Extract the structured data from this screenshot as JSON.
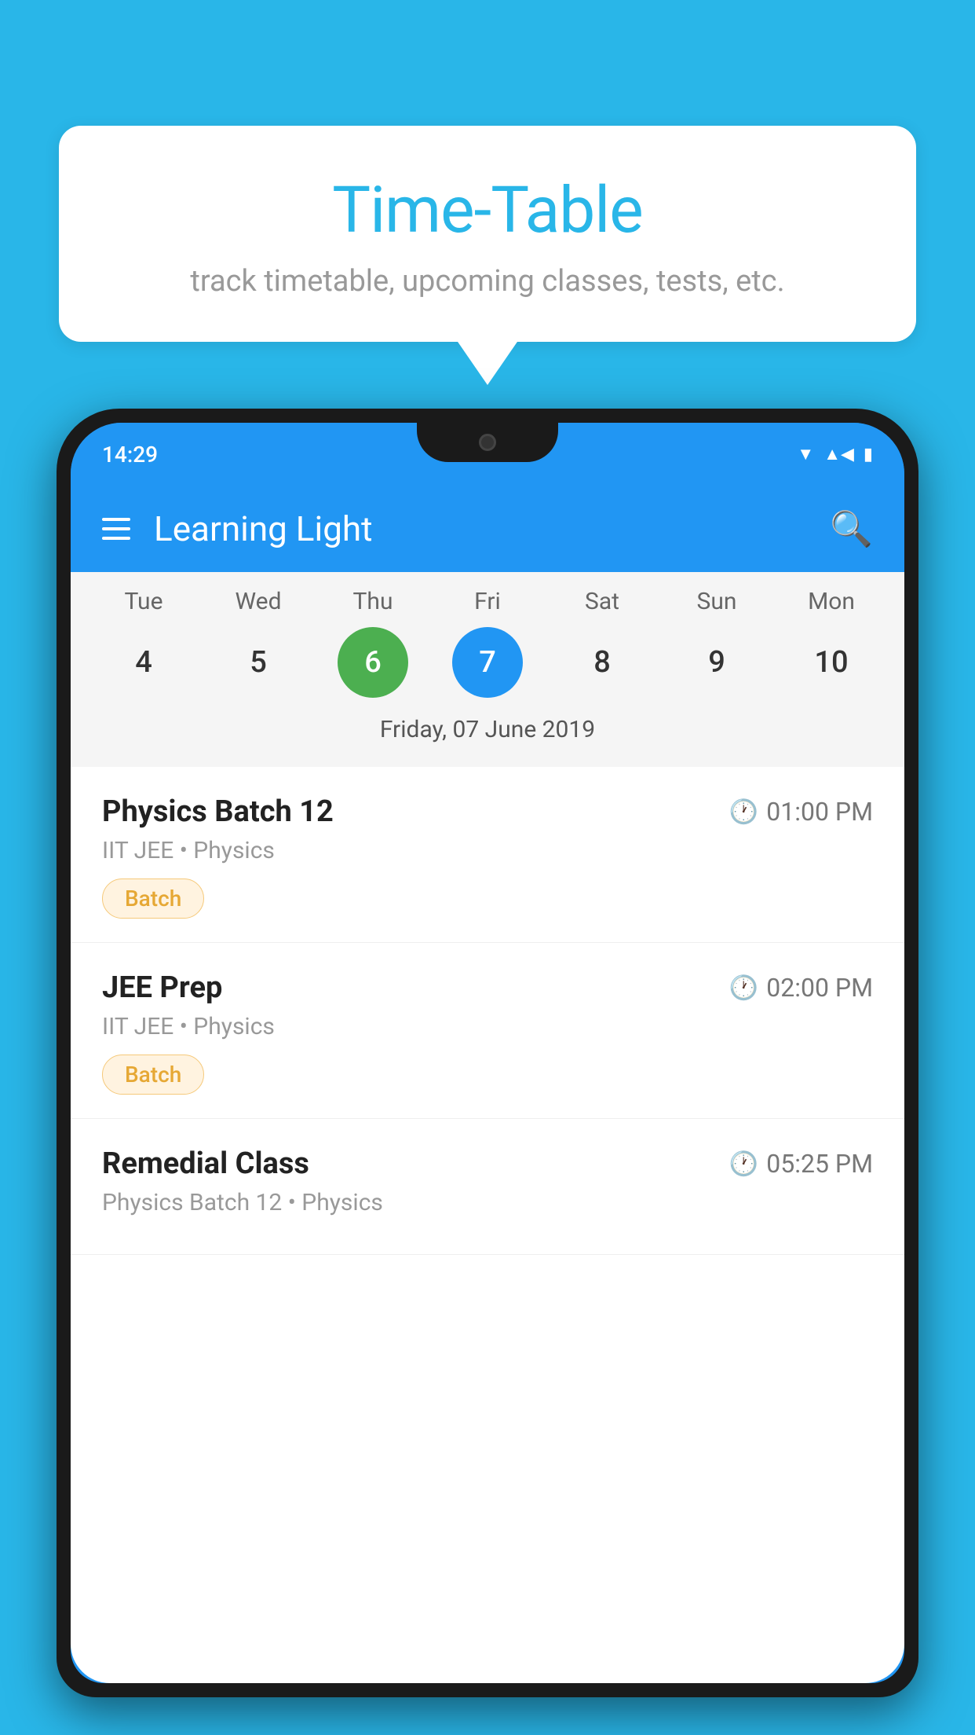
{
  "page": {
    "background_color": "#29B6E8"
  },
  "bubble": {
    "title": "Time-Table",
    "subtitle": "track timetable, upcoming classes, tests, etc."
  },
  "phone": {
    "status_bar": {
      "time": "14:29"
    },
    "app_header": {
      "title": "Learning Light"
    },
    "calendar": {
      "days": [
        {
          "label": "Tue",
          "number": "4"
        },
        {
          "label": "Wed",
          "number": "5"
        },
        {
          "label": "Thu",
          "number": "6",
          "state": "today"
        },
        {
          "label": "Fri",
          "number": "7",
          "state": "selected"
        },
        {
          "label": "Sat",
          "number": "8"
        },
        {
          "label": "Sun",
          "number": "9"
        },
        {
          "label": "Mon",
          "number": "10"
        }
      ],
      "selected_date": "Friday, 07 June 2019"
    },
    "classes": [
      {
        "name": "Physics Batch 12",
        "time": "01:00 PM",
        "meta": "IIT JEE • Physics",
        "tag": "Batch"
      },
      {
        "name": "JEE Prep",
        "time": "02:00 PM",
        "meta": "IIT JEE • Physics",
        "tag": "Batch"
      },
      {
        "name": "Remedial Class",
        "time": "05:25 PM",
        "meta": "Physics Batch 12 • Physics",
        "tag": ""
      }
    ]
  }
}
